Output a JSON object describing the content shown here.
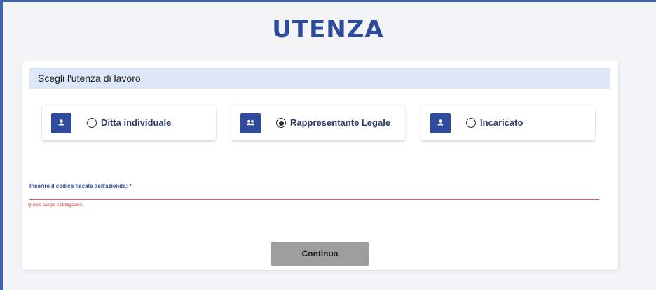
{
  "page": {
    "title": "UTENZA"
  },
  "section": {
    "header": "Scegli l'utenza di lavoro"
  },
  "options": [
    {
      "label": "Ditta individuale",
      "icon": "person-icon",
      "selected": false
    },
    {
      "label": "Rappresentante Legale",
      "icon": "people-icon",
      "selected": true
    },
    {
      "label": "Incaricato",
      "icon": "person-icon",
      "selected": false
    }
  ],
  "fiscal_code": {
    "label": "Inserire il codice fiscale dell'azienda: *",
    "value": "",
    "error": "Questo campo è obbligatorio."
  },
  "actions": {
    "continue_label": "Continua"
  },
  "colors": {
    "accent": "#2f4b9e",
    "header_bg": "#dce8f8",
    "error": "#d93636",
    "button_disabled": "#9e9e9e"
  }
}
